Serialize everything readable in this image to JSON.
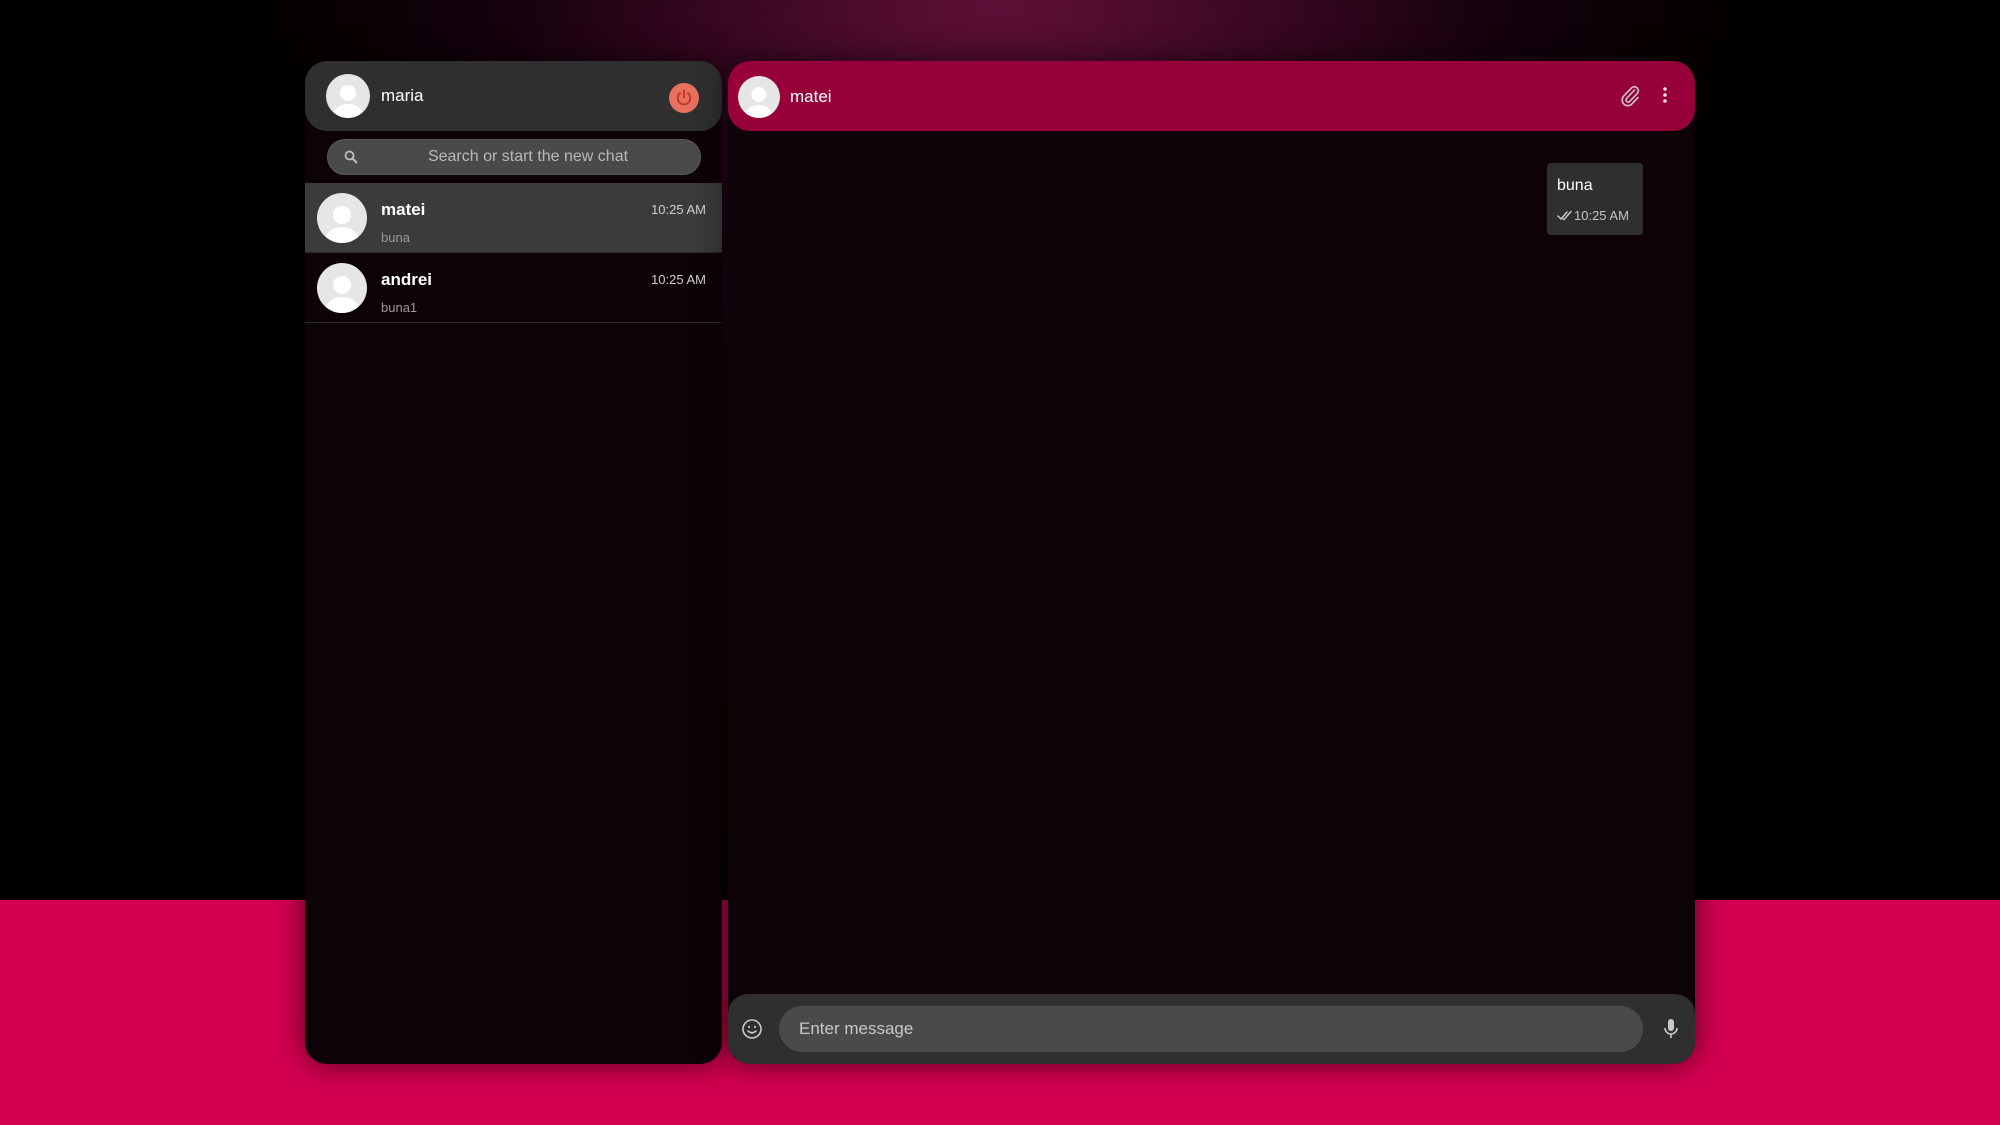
{
  "current_user": {
    "name": "maria",
    "logout_icon": "power-icon"
  },
  "search": {
    "placeholder": "Search or start the new chat",
    "icon": "search-icon"
  },
  "chats": [
    {
      "name": "matei",
      "time": "10:25 AM",
      "preview": "buna",
      "active": true
    },
    {
      "name": "andrei",
      "time": "10:25 AM",
      "preview": "buna1",
      "active": false
    }
  ],
  "conversation": {
    "contact_name": "matei",
    "header_icons": [
      "paperclip-icon",
      "more-vertical-icon"
    ],
    "messages": [
      {
        "text": "buna",
        "time": "10:25 AM",
        "status": "read",
        "status_icon": "double-check-icon",
        "outgoing": true
      }
    ]
  },
  "composer": {
    "placeholder": "Enter message",
    "emoji_icon": "emoji-icon",
    "mic_icon": "microphone-icon"
  },
  "colors": {
    "accent": "#98003a",
    "bottom_band": "#d3004f",
    "panel_bg": "#0d0208",
    "header_gray": "#2f2f2f",
    "power_button": "#e8705f"
  }
}
